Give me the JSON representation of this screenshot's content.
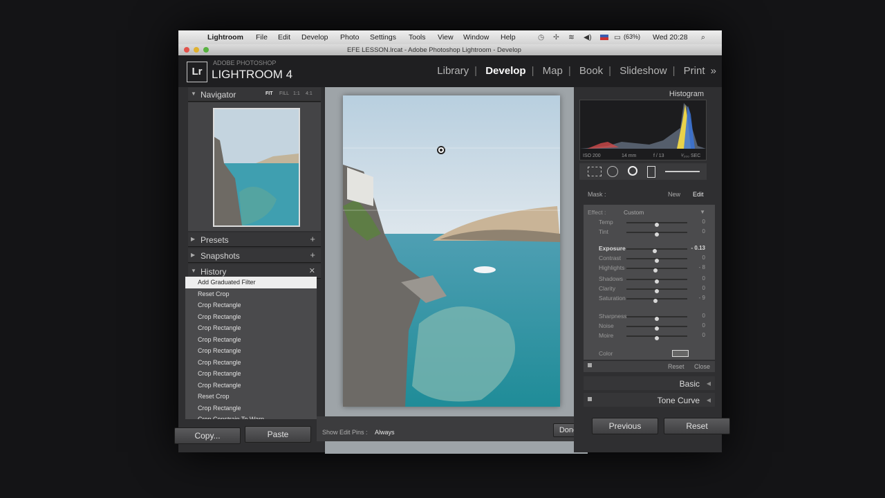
{
  "menubar": {
    "app_name": "Lightroom",
    "items": [
      "File",
      "Edit",
      "Develop",
      "Photo",
      "Settings",
      "Tools",
      "View",
      "Window",
      "Help"
    ],
    "battery": "(63%)",
    "clock": "Wed 20:28"
  },
  "window": {
    "title": "EFE LESSON.lrcat - Adobe Photoshop Lightroom - Develop"
  },
  "brand": {
    "logo": "Lr",
    "subtitle": "ADOBE PHOTOSHOP",
    "name": "LIGHTROOM 4"
  },
  "modules": {
    "library": "Library",
    "develop": "Develop",
    "map": "Map",
    "book": "Book",
    "slideshow": "Slideshow",
    "print": "Print",
    "more": "»",
    "active": "Develop"
  },
  "left": {
    "navigator": {
      "title": "Navigator",
      "fit": "FIT",
      "fill": "FILL",
      "r1": "1:1",
      "r2": "4:1"
    },
    "presets": "Presets",
    "snapshots": "Snapshots",
    "history": {
      "title": "History",
      "items": [
        "Add Graduated Filter",
        "Reset Crop",
        "Crop Rectangle",
        "Crop Rectangle",
        "Crop Rectangle",
        "Crop Rectangle",
        "Crop Rectangle",
        "Crop Rectangle",
        "Crop Rectangle",
        "Crop Rectangle",
        "Reset Crop",
        "Crop Rectangle",
        "Crop Constrain To Warp"
      ]
    },
    "copy_button": "Copy...",
    "paste_button": "Paste"
  },
  "toolbar": {
    "show_edit_pins": "Show Edit Pins :",
    "mode": "Always",
    "done": "Done"
  },
  "right": {
    "histogram": {
      "title": "Histogram",
      "iso": "ISO 200",
      "focal": "14 mm",
      "aperture": "f / 13",
      "shutter": "¹⁄₂₀₀ SEC"
    },
    "mask": {
      "label": "Mask :",
      "new": "New",
      "edit": "Edit"
    },
    "effect": {
      "label": "Effect :",
      "value": "Custom"
    },
    "sliders": [
      {
        "name": "Temp",
        "value": "0",
        "level": 0.5
      },
      {
        "name": "Tint",
        "value": "0",
        "level": 0.5
      },
      {
        "name": "Exposure",
        "value": "- 0.13",
        "level": 0.46
      },
      {
        "name": "Contrast",
        "value": "0",
        "level": 0.5
      },
      {
        "name": "Highlights",
        "value": "- 8",
        "level": 0.47
      },
      {
        "name": "Shadows",
        "value": "0",
        "level": 0.5
      },
      {
        "name": "Clarity",
        "value": "0",
        "level": 0.5
      },
      {
        "name": "Saturation",
        "value": "- 9",
        "level": 0.47
      },
      {
        "name": "Sharpness",
        "value": "0",
        "level": 0.5
      },
      {
        "name": "Noise",
        "value": "0",
        "level": 0.5
      },
      {
        "name": "Moire",
        "value": "0",
        "level": 0.5
      }
    ],
    "color_label": "Color",
    "reset_link": "Reset",
    "close_link": "Close",
    "basic": "Basic",
    "tone_curve": "Tone Curve",
    "previous_button": "Previous",
    "reset_button": "Reset"
  }
}
